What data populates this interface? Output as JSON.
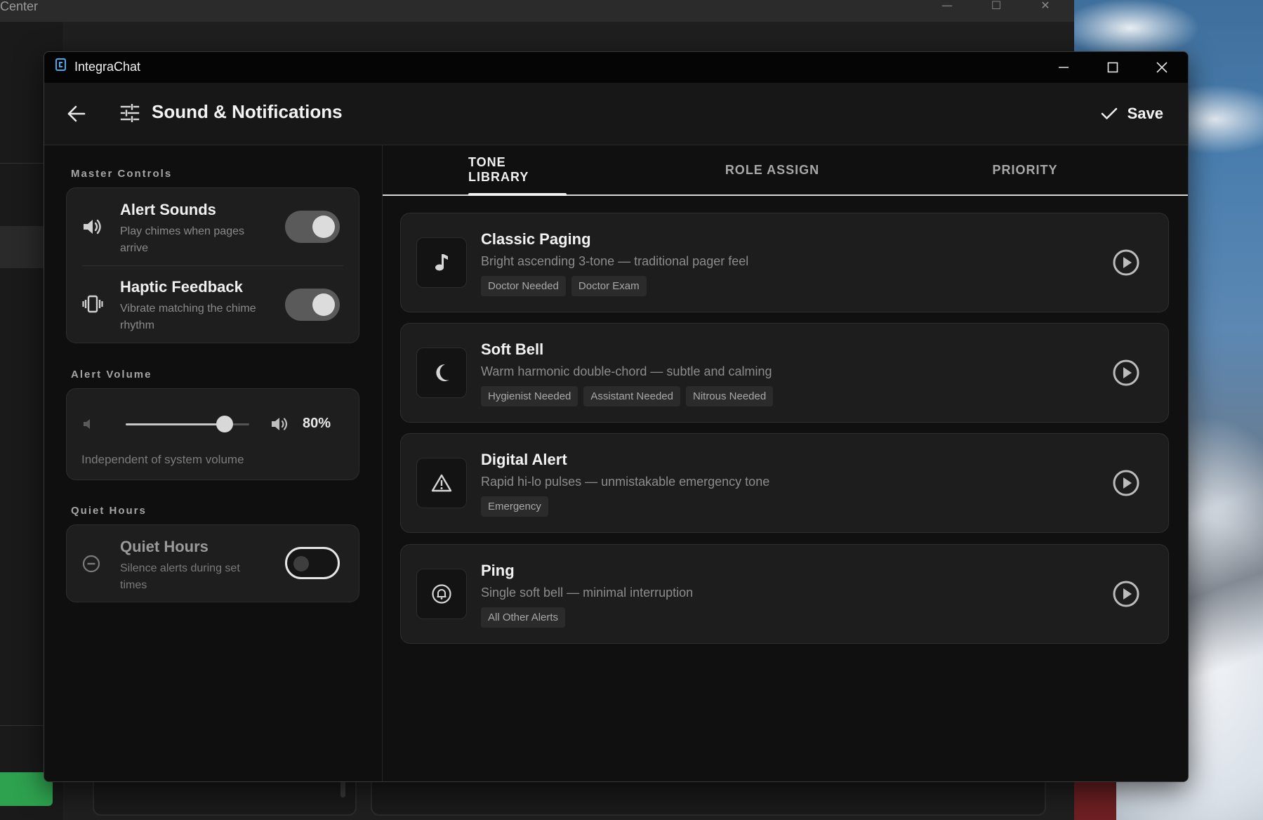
{
  "background_window": {
    "title": "Center"
  },
  "window": {
    "app_title": "IntegraChat"
  },
  "header": {
    "title": "Sound & Notifications",
    "save_label": "Save"
  },
  "sidebar": {
    "master_controls": {
      "label": "Master Controls",
      "alert_sounds": {
        "title": "Alert Sounds",
        "desc": "Play chimes when pages arrive",
        "enabled": true
      },
      "haptic": {
        "title": "Haptic Feedback",
        "desc": "Vibrate matching the chime rhythm",
        "enabled": true
      }
    },
    "alert_volume": {
      "label": "Alert Volume",
      "value_text": "80%",
      "value": 0.8,
      "note": "Independent of system volume"
    },
    "quiet_hours": {
      "label": "Quiet Hours",
      "title": "Quiet Hours",
      "desc": "Silence alerts during set times",
      "enabled": false
    }
  },
  "tabs": [
    {
      "label": "TONE LIBRARY",
      "active": true
    },
    {
      "label": "ROLE ASSIGN",
      "active": false
    },
    {
      "label": "PRIORITY",
      "active": false
    }
  ],
  "tones": [
    {
      "name": "Classic Paging",
      "desc": "Bright ascending 3-tone — traditional pager feel",
      "icon": "music-note-icon",
      "tags": [
        "Doctor Needed",
        "Doctor Exam"
      ]
    },
    {
      "name": "Soft Bell",
      "desc": "Warm harmonic double-chord — subtle and calming",
      "icon": "moon-icon",
      "tags": [
        "Hygienist Needed",
        "Assistant Needed",
        "Nitrous Needed"
      ]
    },
    {
      "name": "Digital Alert",
      "desc": "Rapid hi-lo pulses — unmistakable emergency tone",
      "icon": "warning-triangle-icon",
      "tags": [
        "Emergency"
      ]
    },
    {
      "name": "Ping",
      "desc": "Single soft bell — minimal interruption",
      "icon": "bell-circle-icon",
      "tags": [
        "All Other Alerts"
      ]
    }
  ],
  "colors": {
    "window_bg": "#101010",
    "card_bg": "#1d1d1d",
    "accent_text": "#f0f0f0",
    "muted_text": "#8c8c8c",
    "app_icon": "#4aa8e8"
  }
}
